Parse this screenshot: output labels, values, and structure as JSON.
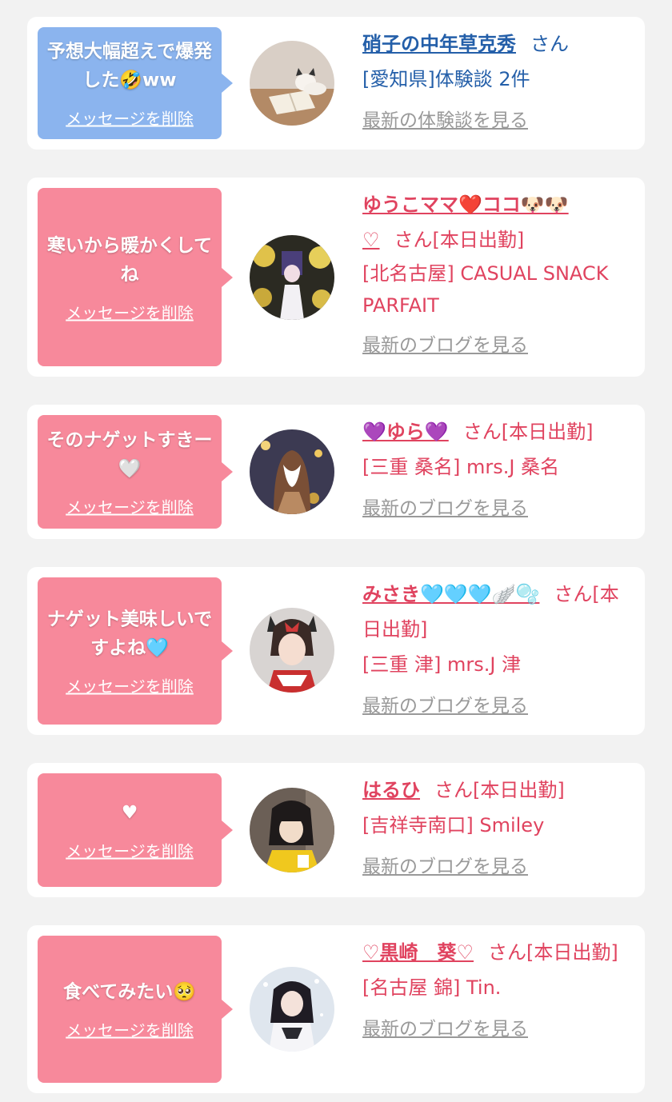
{
  "delete_label": "メッセージを削除",
  "cards": [
    {
      "message": "予想大幅超えで爆発した🤣ww",
      "name": "硝子の中年草克秀",
      "san": "さん",
      "area": "[愛知県]体験談 2件",
      "more": "最新の体験談を見る"
    },
    {
      "message": "寒いから暖かくしてね",
      "name": "ゆうこママ❤️ココ🐶🐶",
      "name_tail": "♡",
      "san": "さん[本日出勤]",
      "area": "[北名古屋] CASUAL SNACK PARFAIT",
      "more": "最新のブログを見る"
    },
    {
      "message": "そのナゲットすきー🤍",
      "name": "💜ゆら💜",
      "san": "さん[本日出勤]",
      "area": "[三重 桑名] mrs.J 桑名",
      "more": "最新のブログを見る"
    },
    {
      "message": "ナゲット美味しいですよね🩵",
      "name": "みさき🩵🩵🩵🪽🫧",
      "san": "さん[本日出勤]",
      "area": "[三重 津] mrs.J 津",
      "more": "最新のブログを見る"
    },
    {
      "message": "♥",
      "name": "はるひ",
      "san": "さん[本日出勤]",
      "area": "[吉祥寺南口] Smiley",
      "more": "最新のブログを見る"
    },
    {
      "message": "食べてみたい🥺",
      "name": "♡黒崎　葵♡",
      "san": "さん[本日出勤]",
      "area": "[名古屋 錦] Tin.",
      "more": "最新のブログを見る"
    }
  ],
  "colors": {
    "background": "#f2f2f2",
    "card": "#ffffff",
    "bubble_blue": "#8bb4ee",
    "bubble_pink": "#f7899b",
    "name_pink": "#e0435f",
    "name_blue": "#245fa9",
    "link_gray": "#999999"
  }
}
